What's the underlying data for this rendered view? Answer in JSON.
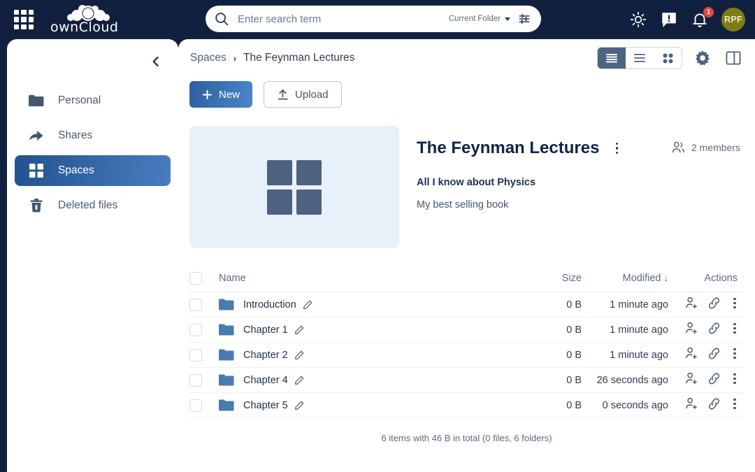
{
  "topbar": {
    "app_grid_icon": "apps-grid-icon",
    "logo_text": "ownCloud",
    "search": {
      "icon": "search-icon",
      "placeholder": "Enter search term",
      "value": "",
      "scope_label": "Current Folder",
      "filter_icon": "filter-sliders-icon"
    },
    "theme_icon": "sun-icon",
    "feedback_icon": "feedback-icon",
    "notifications_icon": "bell-icon",
    "notifications_count": "1",
    "avatar_initials": "RPF",
    "accent_color": "#12203f",
    "badge_color": "#e8453c",
    "avatar_color": "#7d7d13"
  },
  "sidebar": {
    "collapse_icon": "chevron-left-icon",
    "items": [
      {
        "label": "Personal",
        "icon": "folder-icon",
        "active": false
      },
      {
        "label": "Shares",
        "icon": "share-arrow-icon",
        "active": false
      },
      {
        "label": "Spaces",
        "icon": "spaces-grid-icon",
        "active": true
      },
      {
        "label": "Deleted files",
        "icon": "trash-icon",
        "active": false
      }
    ],
    "active_color": "#4a7cc0"
  },
  "breadcrumb": {
    "root": "Spaces",
    "separator": "›",
    "current": "The Feynman Lectures"
  },
  "view_toggle": {
    "buttons": [
      {
        "icon": "view-condensed-icon",
        "active": true
      },
      {
        "icon": "view-list-icon",
        "active": false
      },
      {
        "icon": "view-tiles-icon",
        "active": false
      }
    ],
    "settings_icon": "gear-icon",
    "sidepanel_icon": "side-panel-icon"
  },
  "actions": {
    "new_label": "New",
    "new_icon": "plus-icon",
    "upload_label": "Upload",
    "upload_icon": "upload-arrow-icon"
  },
  "space": {
    "thumbnail_icon": "spaces-grid-icon",
    "thumbnail_bg": "#e8f0f9",
    "title": "The Feynman Lectures",
    "menu_icon": "more-vertical-icon",
    "members_icon": "members-icon",
    "members_label": "2 members",
    "subtitle": "All I know about Physics",
    "description": "My best selling book"
  },
  "table": {
    "headers": {
      "name": "Name",
      "size": "Size",
      "modified": "Modified",
      "sort_arrow": "↓",
      "actions": "Actions"
    },
    "rows": [
      {
        "name": "Introduction",
        "size": "0 B",
        "modified": "1 minute ago",
        "icon": "folder-icon"
      },
      {
        "name": "Chapter 1",
        "size": "0 B",
        "modified": "1 minute ago",
        "icon": "folder-icon"
      },
      {
        "name": "Chapter 2",
        "size": "0 B",
        "modified": "1 minute ago",
        "icon": "folder-icon"
      },
      {
        "name": "Chapter 4",
        "size": "0 B",
        "modified": "26 seconds ago",
        "icon": "folder-icon"
      },
      {
        "name": "Chapter 5",
        "size": "0 B",
        "modified": "0 seconds ago",
        "icon": "folder-icon"
      }
    ],
    "row_icons": {
      "edit": "pencil-icon",
      "share": "add-person-icon",
      "link": "link-icon",
      "more": "more-vertical-icon"
    },
    "footer": "6 items with 46 B in total (0 files, 6 folders)"
  }
}
